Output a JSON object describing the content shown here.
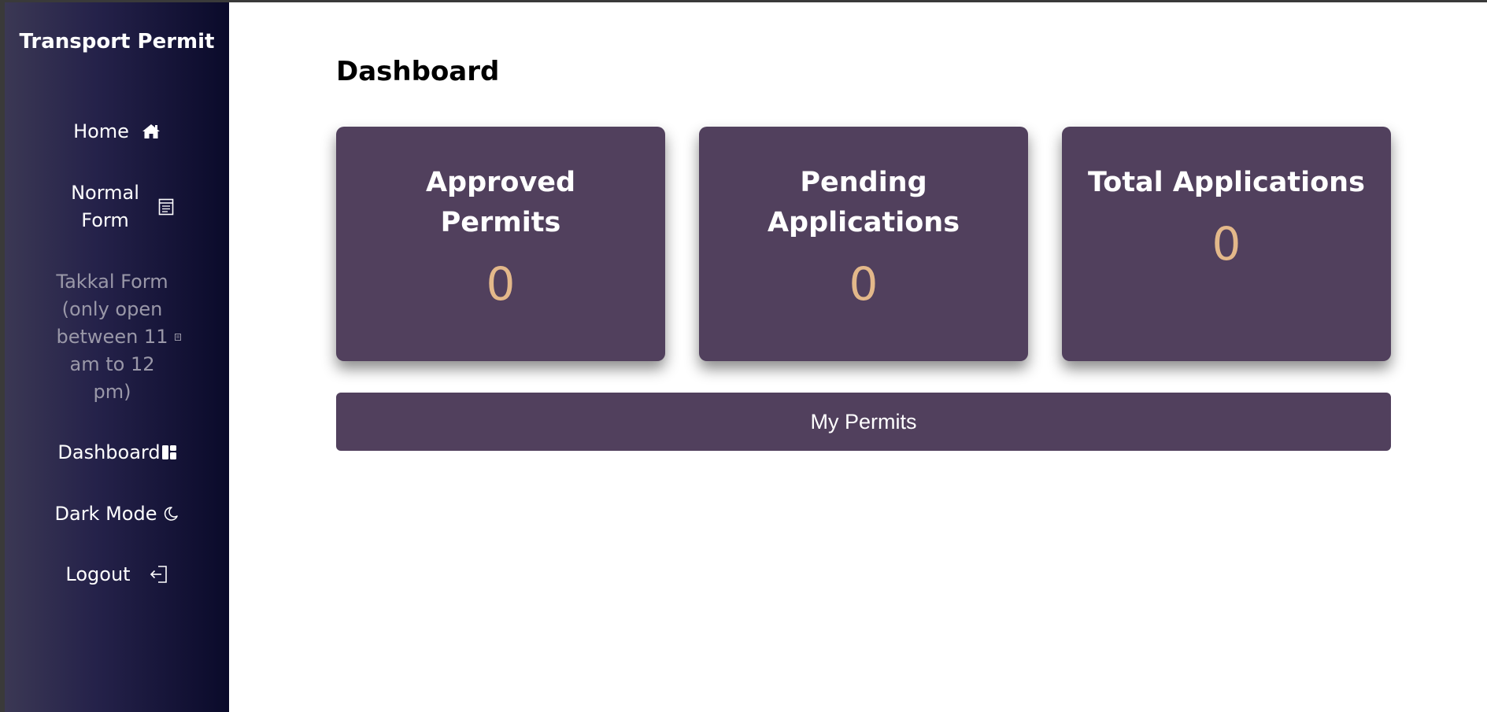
{
  "sidebar": {
    "brand": "Transport Permit",
    "items": [
      {
        "label": "Home",
        "icon": "home-icon"
      },
      {
        "label": "Normal Form",
        "icon": "form-icon"
      },
      {
        "label": "Takkal Form (only open between 11 am to 12 pm)",
        "icon": "form-icon",
        "disabled": true
      },
      {
        "label": "Dashboard",
        "icon": "dashboard-icon"
      },
      {
        "label": "Dark Mode",
        "icon": "moon-icon"
      },
      {
        "label": "Logout",
        "icon": "logout-icon"
      }
    ]
  },
  "main": {
    "title": "Dashboard",
    "cards": [
      {
        "title": "Approved Permits",
        "value": "0"
      },
      {
        "title": "Pending Applications",
        "value": "0"
      },
      {
        "title": "Total Applications",
        "value": "0"
      }
    ],
    "my_permits_label": "My Permits"
  },
  "colors": {
    "card_bg": "#51405d",
    "value_accent": "#e3b88a",
    "sidebar_dark": "#0a0a2a"
  }
}
